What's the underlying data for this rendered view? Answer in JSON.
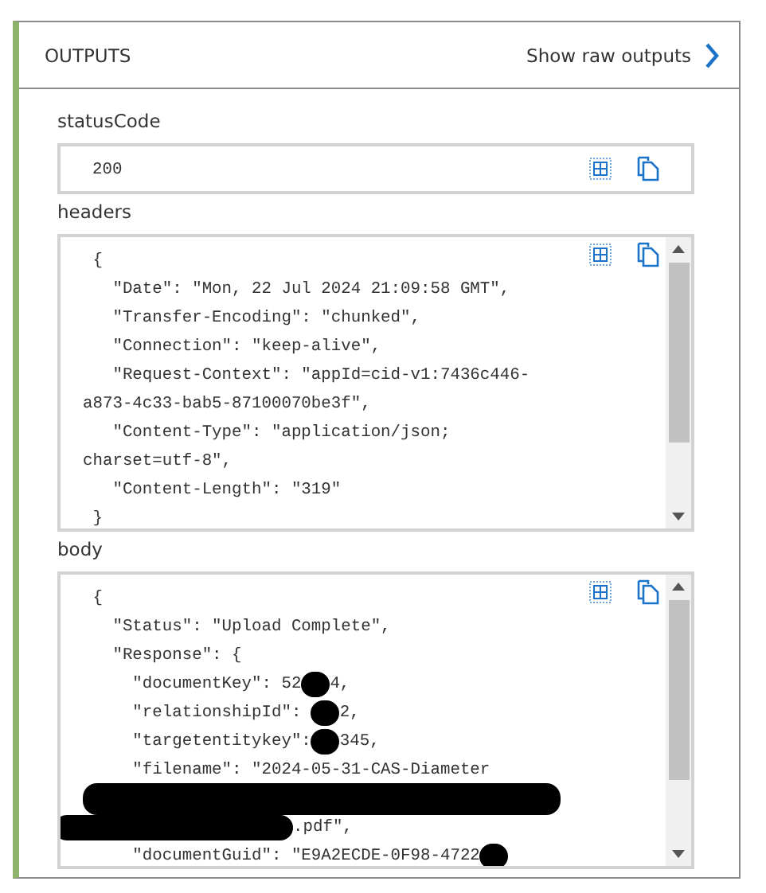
{
  "panel": {
    "title": "OUTPUTS",
    "action": "Show raw outputs"
  },
  "fields": [
    {
      "label": "statusCode",
      "kind": "single",
      "lines": [
        {
          "segments": [
            {
              "kind": "text",
              "text": "200"
            }
          ]
        }
      ]
    },
    {
      "label": "headers",
      "kind": "multi",
      "lines": [
        {
          "segments": [
            {
              "kind": "text",
              "text": " {"
            }
          ]
        },
        {
          "segments": [
            {
              "kind": "text",
              "text": "   \"Date\": \"Mon, 22 Jul 2024 21:09:58 GMT\","
            }
          ]
        },
        {
          "segments": [
            {
              "kind": "text",
              "text": "   \"Transfer-Encoding\": \"chunked\","
            }
          ]
        },
        {
          "segments": [
            {
              "kind": "text",
              "text": "   \"Connection\": \"keep-alive\","
            }
          ]
        },
        {
          "segments": [
            {
              "kind": "text",
              "text": "   \"Request-Context\": \"appId=cid-v1:7436c446-"
            }
          ]
        },
        {
          "segments": [
            {
              "kind": "text",
              "text": "a873-4c33-bab5-87100070be3f\","
            }
          ]
        },
        {
          "segments": [
            {
              "kind": "text",
              "text": "   \"Content-Type\": \"application/json;"
            }
          ]
        },
        {
          "segments": [
            {
              "kind": "text",
              "text": "charset=utf-8\","
            }
          ]
        },
        {
          "segments": [
            {
              "kind": "text",
              "text": "   \"Content-Length\": \"319\""
            }
          ]
        },
        {
          "segments": [
            {
              "kind": "text",
              "text": " }"
            }
          ]
        }
      ]
    },
    {
      "label": "body",
      "kind": "multi",
      "lines": [
        {
          "segments": [
            {
              "kind": "text",
              "text": " {"
            }
          ]
        },
        {
          "segments": [
            {
              "kind": "text",
              "text": "   \"Status\": \"Upload Complete\","
            }
          ]
        },
        {
          "segments": [
            {
              "kind": "text",
              "text": "   \"Response\": {"
            }
          ]
        },
        {
          "segments": [
            {
              "kind": "text",
              "text": "     \"documentKey\": 52"
            },
            {
              "kind": "redaction"
            },
            {
              "kind": "text",
              "text": "4,"
            }
          ]
        },
        {
          "segments": [
            {
              "kind": "text",
              "text": "     \"relationshipId\": "
            },
            {
              "kind": "redaction"
            },
            {
              "kind": "text",
              "text": "2,"
            }
          ]
        },
        {
          "segments": [
            {
              "kind": "text",
              "text": "     \"targetentitykey\":"
            },
            {
              "kind": "redaction"
            },
            {
              "kind": "text",
              "text": "345,"
            }
          ]
        },
        {
          "segments": [
            {
              "kind": "text",
              "text": "     \"filename\": \"2024-05-31-CAS-Diameter"
            }
          ]
        },
        {
          "segments": [
            {
              "kind": "redaction_line"
            }
          ]
        },
        {
          "segments": [
            {
              "kind": "redaction_wide"
            },
            {
              "kind": "text",
              "text": ".pdf\","
            }
          ]
        },
        {
          "segments": [
            {
              "kind": "text",
              "text": "     \"documentGuid\": \"E9A2ECDE-0F98-4722"
            },
            {
              "kind": "redaction"
            }
          ]
        }
      ]
    }
  ]
}
